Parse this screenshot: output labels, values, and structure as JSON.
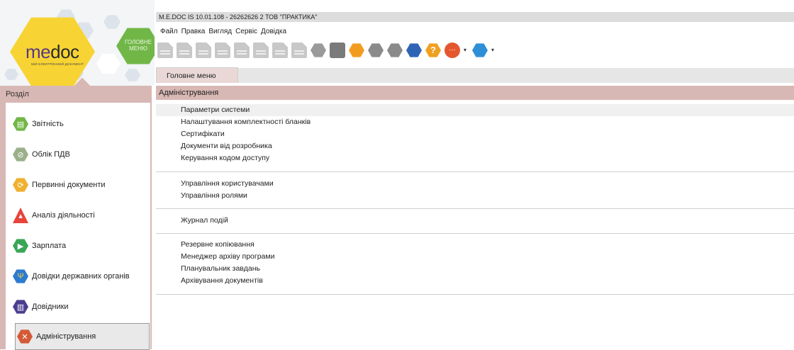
{
  "app": {
    "title": "M.E.DOC IS 10.01.108  - 26262626 2 ТОВ \"ПРАКТИКА\"",
    "logo_me": "me",
    "logo_doc": "doc",
    "logo_subtitle": "МІЙ ЕЛЕКТРОННИЙ ДОКУМЕНТ",
    "menu_hex_label": "ГОЛОВНЕ МЕНЮ"
  },
  "menu": [
    "Файл",
    "Правка",
    "Вигляд",
    "Сервіс",
    "Довідка"
  ],
  "toolbar": [
    {
      "icon": "new-document-icon",
      "color": "#c8c8c8"
    },
    {
      "icon": "open-document-icon",
      "color": "#c8c8c8"
    },
    {
      "icon": "delete-document-icon",
      "color": "#c8c8c8"
    },
    {
      "icon": "copy-document-icon",
      "color": "#c8c8c8"
    },
    {
      "icon": "edit-document-icon",
      "color": "#c8c8c8"
    },
    {
      "icon": "add-row-icon",
      "color": "#c8c8c8"
    },
    {
      "icon": "view-row-icon",
      "color": "#c8c8c8"
    },
    {
      "icon": "delete-row-icon",
      "color": "#c8c8c8"
    },
    {
      "icon": "archive-icon",
      "color": "#9a9a9a"
    },
    {
      "icon": "print-icon",
      "color": "#7a7a7a"
    },
    {
      "icon": "box-icon",
      "color": "#f29c1f"
    },
    {
      "icon": "seal-icon",
      "color": "#8a8a8a"
    },
    {
      "icon": "envelope-icon",
      "color": "#8a8a8a"
    },
    {
      "icon": "update-icon",
      "color": "#2f63b5"
    },
    {
      "icon": "help-icon",
      "color": "#f0a020"
    },
    {
      "icon": "chat-icon",
      "color": "#e4572e"
    },
    {
      "icon": "settings-icon",
      "color": "#2f8fd6"
    }
  ],
  "tab": {
    "label": "Головне меню"
  },
  "sidebar": {
    "title": "Розділ",
    "items": [
      {
        "label": "Звітність",
        "icon": "report-icon",
        "color": "#71b748"
      },
      {
        "label": "Облік ПДВ",
        "icon": "vat-icon",
        "color": "#9ab08a"
      },
      {
        "label": "Первинні документи",
        "icon": "primary-docs-icon",
        "color": "#f0b030"
      },
      {
        "label": "Аналіз діяльності",
        "icon": "analysis-icon",
        "color": "#e8443a"
      },
      {
        "label": "Зарплата",
        "icon": "salary-icon",
        "color": "#3aa655"
      },
      {
        "label": "Довідки державних органів",
        "icon": "state-references-icon",
        "color": "#2d7bd0"
      },
      {
        "label": "Довідники",
        "icon": "directories-icon",
        "color": "#4a3d8f"
      },
      {
        "label": "Адміністрування",
        "icon": "administration-icon",
        "color": "#d45a36"
      }
    ]
  },
  "content": {
    "header": "Адміністрування",
    "groups": [
      [
        "Параметри системи",
        "Налаштування комплектності бланків",
        "Сертифікати",
        "Документи від розробника",
        "Керування кодом доступу"
      ],
      [
        "Управління користувачами",
        "Управління ролями"
      ],
      [
        "Журнал подій"
      ],
      [
        "Резервне копіювання",
        "Менеджер архіву програми",
        "Планувальник завдань",
        "Архівування документів"
      ]
    ]
  }
}
